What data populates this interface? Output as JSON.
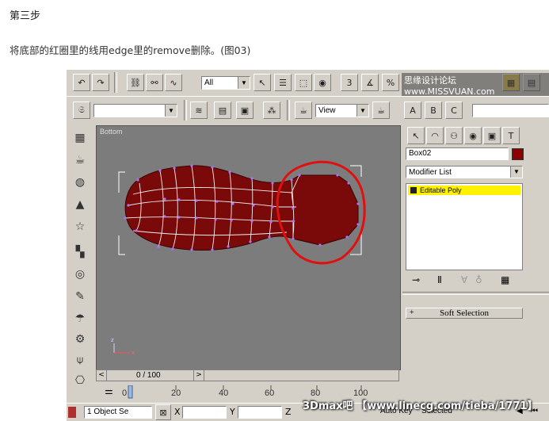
{
  "article": {
    "heading": "第三步",
    "description": "将底部的红圈里的线用edge里的remove删除。(图03)"
  },
  "toolbar": {
    "selection_filter": "All",
    "view_dropdown": "View",
    "named_selection": ""
  },
  "watermark_top": "思缘设计论坛 www.MISSVUAN.com",
  "watermark_bottom": "3Dmax吧 【www.linecg.com/tieba/1771】",
  "viewport": {
    "label": "Bottom"
  },
  "command_panel": {
    "object_name": "Box02",
    "object_color": "#8b0000",
    "modifier_list": "Modifier List",
    "stack_item": "Editable Poly",
    "rollout_soft_selection": "Soft Selection",
    "rollout_toggle": "+"
  },
  "timeline": {
    "frame": "0 / 100",
    "ticks": [
      "0",
      "20",
      "40",
      "60",
      "80",
      "100"
    ]
  },
  "statusbar": {
    "selection": "1 Object Se",
    "x_label": "X",
    "y_label": "Y",
    "z_label": "Z",
    "auto_key": "Auto Key",
    "selected": "Selected"
  },
  "colors": {
    "mesh_fill": "#7a0a0a",
    "highlight_circle": "#e01010",
    "stack_highlight": "#fff200"
  }
}
